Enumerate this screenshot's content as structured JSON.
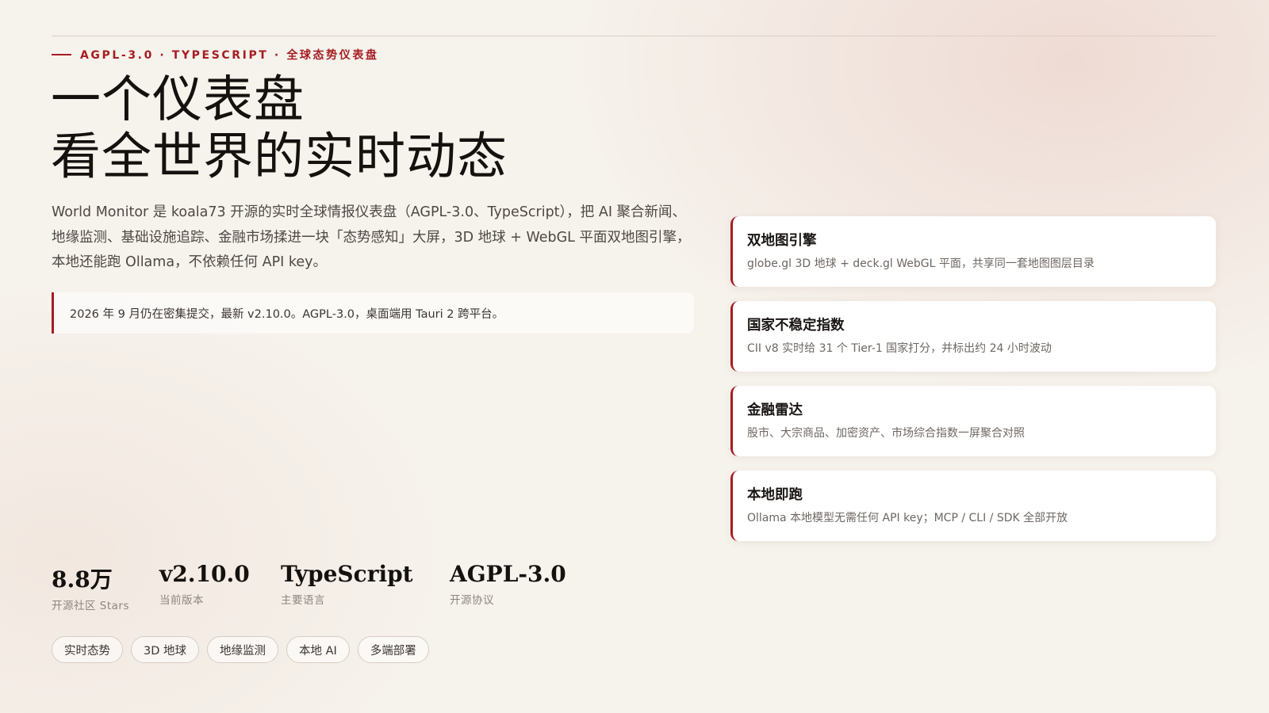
{
  "eyebrow": "AGPL-3.0 · TYPESCRIPT · 全球态势仪表盘",
  "hero": {
    "line1": "一个仪表盘",
    "line2": "看全世界的实时动态"
  },
  "intro": "World Monitor 是 koala73 开源的实时全球情报仪表盘（AGPL-3.0、TypeScript），把 AI 聚合新闻、地缘监测、基础设施追踪、金融市场揉进一块「态势感知」大屏，3D 地球 + WebGL 平面双地图引擎，本地还能跑 Ollama，不依赖任何 API key。",
  "callout": "2026 年 9 月仍在密集提交，最新 v2.10.0。AGPL-3.0，桌面端用 Tauri 2 跨平台。",
  "features": [
    {
      "title": "双地图引擎",
      "desc": "globe.gl 3D 地球 + deck.gl WebGL 平面，共享同一套地图图层目录"
    },
    {
      "title": "国家不稳定指数",
      "desc": "CII v8 实时给 31 个 Tier-1 国家打分，并标出约 24 小时波动"
    },
    {
      "title": "金融雷达",
      "desc": "股市、大宗商品、加密资产、市场综合指数一屏聚合对照"
    },
    {
      "title": "本地即跑",
      "desc": "Ollama 本地模型无需任何 API key；MCP / CLI / SDK 全部开放"
    }
  ],
  "stats": [
    {
      "value": "8.8万",
      "label": "开源社区 Stars"
    },
    {
      "value": "v2.10.0",
      "label": "当前版本"
    },
    {
      "value": "TypeScript",
      "label": "主要语言"
    },
    {
      "value": "AGPL-3.0",
      "label": "开源协议"
    }
  ],
  "tags": [
    "实时态势",
    "3D 地球",
    "地缘监测",
    "本地 AI",
    "多端部署"
  ],
  "colors": {
    "accent": "#a51d22",
    "background": "#f6f2ec",
    "card": "#ffffff"
  }
}
